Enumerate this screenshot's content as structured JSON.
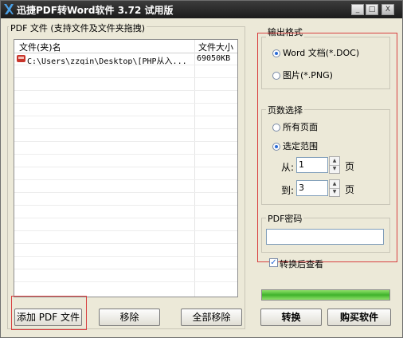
{
  "window": {
    "title": "迅捷PDF转Word软件 3.72 试用版",
    "controls": {
      "minimize": "_",
      "maximize": "□",
      "close": "X"
    }
  },
  "file_panel": {
    "group_label": "PDF 文件 (支持文件及文件夹拖拽)",
    "columns": [
      "文件(夹)名",
      "文件大小"
    ],
    "rows": [
      {
        "name": "C:\\Users\\zzqin\\Desktop\\[PHP从入...",
        "size": "69050KB"
      }
    ]
  },
  "buttons": {
    "add_pdf": "添加 PDF 文件",
    "remove": "移除",
    "remove_all": "全部移除",
    "convert": "转换",
    "buy": "购买软件"
  },
  "output_format": {
    "label": "输出格式",
    "options": [
      "Word 文档(*.DOC)",
      "图片(*.PNG)"
    ],
    "selected_index": 0
  },
  "page_select": {
    "label": "页数选择",
    "options": [
      "所有页面",
      "选定范围"
    ],
    "selected_index": 1,
    "from_label": "从:",
    "from_value": "1",
    "to_label": "到:",
    "to_value": "3",
    "unit": "页"
  },
  "password": {
    "label": "PDF密码",
    "value": ""
  },
  "view_after": {
    "label": "转换后查看",
    "checked": true
  },
  "progress": {
    "value": 1.0
  }
}
